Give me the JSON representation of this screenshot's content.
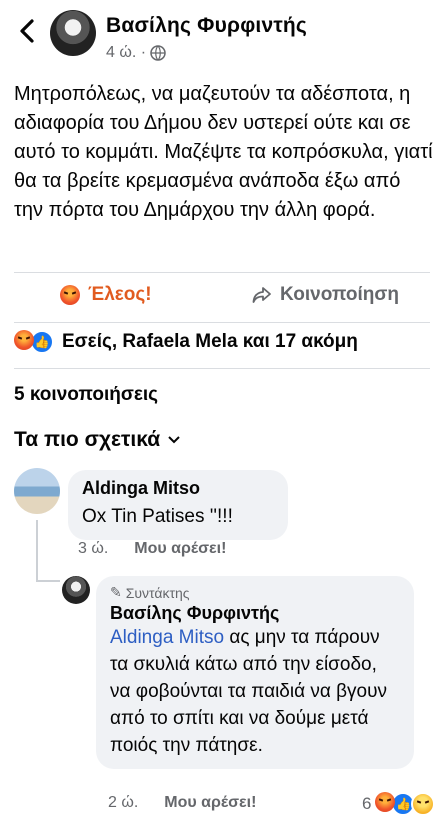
{
  "header": {
    "author": "Βασίλης Φυρφιντής",
    "time": "4 ώ. ·"
  },
  "post": {
    "text": "Μητροπόλεως, να μαζευτούν τα αδέσποτα, η αδιαφορία του Δήμου δεν υστερεί ούτε και σε αυτό το κομμάτι. Μαζέψτε τα κοπρόσκυλα, γιατί θα τα βρείτε κρεμασμένα ανάποδα έξω από την πόρτα του Δημάρχου την άλλη φορά."
  },
  "actions": {
    "reaction_label": "Έλεος!",
    "share_label": "Κοινοποίηση"
  },
  "reactions": {
    "summary": "Εσείς, Rafaela Mela και 17 ακόμη"
  },
  "shares": "5 κοινοποιήσεις",
  "filter": "Τα πιο σχετικά",
  "comments": [
    {
      "name": "Aldinga Mitso",
      "text": "Ox   Tin  Patises  ''!!!",
      "time": "3 ώ.",
      "like_label": "Μου αρέσει!"
    }
  ],
  "reply": {
    "badge": "Συντάκτης",
    "name": "Βασίλης Φυρφιντής",
    "mention": "Aldinga Mitso",
    "text": " ας μην τα πάρουν τα σκυλιά κάτω από την είσοδο, να φοβούνται τα παιδιά να βγουν από το σπίτι και να δούμε μετά ποιός την πάτησε.",
    "time": "2 ώ.",
    "like_label": "Μου αρέσει!",
    "reaction_count": "6"
  }
}
